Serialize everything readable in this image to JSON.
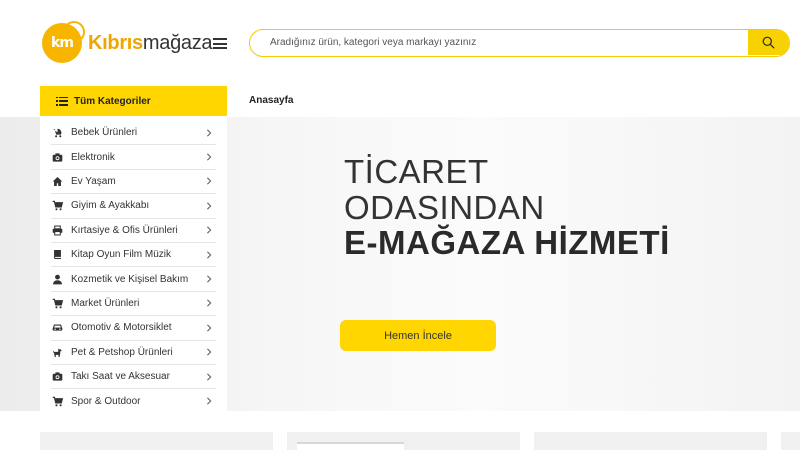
{
  "header": {
    "logo_mark": "km",
    "logo_bold": "Kıbrıs",
    "logo_regular": "mağaza",
    "search_placeholder": "Aradığınız ürün, kategori veya markayı yazınız"
  },
  "categories_header": "Tüm Kategoriler",
  "breadcrumb": "Anasayfa",
  "categories": [
    {
      "label": "Bebek Ürünleri",
      "icon": "baby-carriage-icon"
    },
    {
      "label": "Elektronik",
      "icon": "camera-icon"
    },
    {
      "label": "Ev Yaşam",
      "icon": "home-icon"
    },
    {
      "label": "Giyim & Ayakkabı",
      "icon": "cart-icon"
    },
    {
      "label": "Kırtasiye & Ofis Ürünleri",
      "icon": "printer-icon"
    },
    {
      "label": "Kitap Oyun Film Müzik",
      "icon": "book-icon"
    },
    {
      "label": "Kozmetik ve Kişisel Bakım",
      "icon": "user-icon"
    },
    {
      "label": "Market Ürünleri",
      "icon": "cart-icon"
    },
    {
      "label": "Otomotiv & Motorsiklet",
      "icon": "car-icon"
    },
    {
      "label": "Pet & Petshop Ürünleri",
      "icon": "dog-icon"
    },
    {
      "label": "Takı Saat ve Aksesuar",
      "icon": "camera-icon"
    },
    {
      "label": "Spor & Outdoor",
      "icon": "cart-icon"
    }
  ],
  "hero": {
    "line1": "TİCARET",
    "line2": "ODASINDAN",
    "line3": "E-MAĞAZA HİZMETİ",
    "button": "Hemen İncele"
  },
  "colors": {
    "accent": "#ffd600",
    "logo": "#f7b500"
  }
}
